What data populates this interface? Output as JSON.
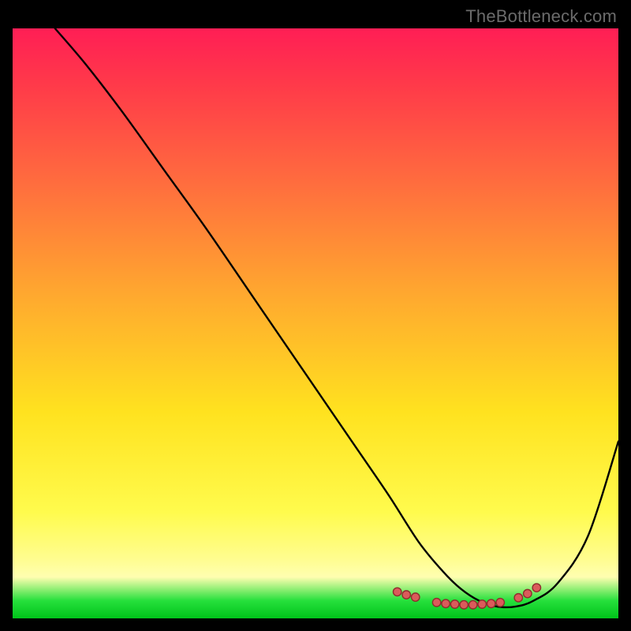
{
  "watermark": "TheBottleneck.com",
  "chart_data": {
    "type": "line",
    "title": "",
    "xlabel": "",
    "ylabel": "",
    "xlim": [
      0,
      100
    ],
    "ylim": [
      0,
      100
    ],
    "grid": false,
    "legend": false,
    "background_gradient": {
      "stops": [
        {
          "pos": 0.0,
          "color": "#ff1e55"
        },
        {
          "pos": 0.1,
          "color": "#ff3b49"
        },
        {
          "pos": 0.25,
          "color": "#ff693f"
        },
        {
          "pos": 0.45,
          "color": "#ffa82f"
        },
        {
          "pos": 0.65,
          "color": "#ffe21f"
        },
        {
          "pos": 0.82,
          "color": "#fffb4d"
        },
        {
          "pos": 0.9,
          "color": "#fffd90"
        },
        {
          "pos": 0.93,
          "color": "#fffeb0"
        },
        {
          "pos": 0.97,
          "color": "#26e03c"
        },
        {
          "pos": 1.0,
          "color": "#00c31a"
        }
      ]
    },
    "series": [
      {
        "name": "bottleneck-curve",
        "x": [
          7,
          12,
          18,
          25,
          32,
          40,
          48,
          56,
          62,
          67,
          71,
          74,
          77,
          80,
          83,
          86,
          90,
          95,
          100
        ],
        "y": [
          100,
          94,
          86,
          76,
          66,
          54,
          42,
          30,
          21,
          13,
          8,
          5,
          3,
          2,
          2,
          3,
          6,
          14,
          30
        ]
      }
    ],
    "marker_points": {
      "name": "highlight-dots",
      "x": [
        63.5,
        65.0,
        66.5,
        70.0,
        71.5,
        73.0,
        74.5,
        76.0,
        77.5,
        79.0,
        80.5,
        83.5,
        85.0,
        86.5
      ],
      "y": [
        4.5,
        4.0,
        3.6,
        2.7,
        2.5,
        2.4,
        2.3,
        2.3,
        2.4,
        2.5,
        2.7,
        3.5,
        4.2,
        5.2
      ]
    }
  }
}
